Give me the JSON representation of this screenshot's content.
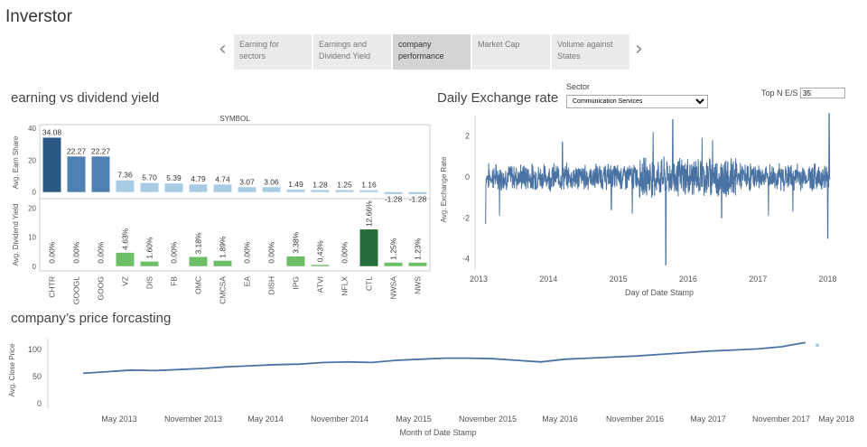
{
  "app": {
    "title": "Inverstor"
  },
  "tabs": [
    {
      "label_line1": "Earning for",
      "label_line2": "sectors",
      "active": false
    },
    {
      "label_line1": "Earnings and",
      "label_line2": "Dividend Yield",
      "active": false
    },
    {
      "label_line1": "company",
      "label_line2": "performance",
      "active": true
    },
    {
      "label_line1": "Market Cap",
      "label_line2": "",
      "active": false
    },
    {
      "label_line1": "Volume against",
      "label_line2": "States",
      "active": false
    }
  ],
  "nav": {
    "prev": "‹",
    "next": "›"
  },
  "earning_section": {
    "title": "earning vs dividend yield",
    "header": "SYMBOL",
    "eps_axis_label": "Avg. Earn Share",
    "div_axis_label": "Avg. Dividend Yield"
  },
  "exchange_section": {
    "title": "Daily Exchange rate",
    "sector_label": "Sector",
    "sector_value": "Communication Services",
    "topn_label": "Top N E/S",
    "topn_value": "35",
    "y_label": "Avg. Exchange Rate",
    "x_label": "Day of Date Stamp"
  },
  "forecast_section": {
    "title": "company’s price forcasting",
    "y_label": "Avg. Close Price",
    "x_label": "Month of Date Stamp"
  },
  "colors": {
    "eps_dark": "#2a5783",
    "eps_mid": "#4f80b4",
    "eps_light": "#a8cce6",
    "div_dark": "#266d3a",
    "div_mid": "#6cbf66",
    "line": "#4a73a3"
  },
  "chart_data": [
    {
      "type": "bar",
      "title": "",
      "ylabel": "Avg. Earn Share",
      "categories": [
        "CHTR",
        "GOOGL",
        "GOOG",
        "VZ",
        "DIS",
        "FB",
        "OMC",
        "CMCSA",
        "EA",
        "DISH",
        "IPG",
        "ATVI",
        "NFLX",
        "CTL",
        "NWSA",
        "NWS"
      ],
      "values": [
        34.08,
        22.27,
        22.27,
        7.36,
        5.7,
        5.39,
        4.79,
        4.74,
        3.07,
        3.06,
        1.49,
        1.28,
        1.25,
        1.16,
        -1.28,
        -1.28
      ],
      "labels": [
        "34.08",
        "22.27",
        "22.27",
        "7.36",
        "5.70",
        "5.39",
        "4.79",
        "4.74",
        "3.07",
        "3.06",
        "1.49",
        "1.28",
        "1.25",
        "1.16",
        "-1.28",
        "-1.28"
      ],
      "ylim": [
        -3,
        40
      ],
      "yticks": [
        "0",
        "20",
        "40"
      ]
    },
    {
      "type": "bar",
      "title": "",
      "ylabel": "Avg. Dividend Yield",
      "categories": [
        "CHTR",
        "GOOGL",
        "GOOG",
        "VZ",
        "DIS",
        "FB",
        "OMC",
        "CMCSA",
        "EA",
        "DISH",
        "IPG",
        "ATVI",
        "NFLX",
        "CTL",
        "NWSA",
        "NWS"
      ],
      "values": [
        0,
        0,
        0,
        4.63,
        1.6,
        0,
        3.18,
        1.89,
        0,
        0,
        3.38,
        0.43,
        0,
        12.66,
        1.25,
        1.23
      ],
      "labels": [
        "0.00%",
        "0.00%",
        "0.00%",
        "4.63%",
        "1.60%",
        "0.00%",
        "3.18%",
        "1.89%",
        "0.00%",
        "0.00%",
        "3.38%",
        "0.43%",
        "0.00%",
        "12.66%",
        "1.25%",
        "1.23%"
      ],
      "ylim": [
        -1,
        22
      ],
      "yticks": [
        "0",
        "10",
        "20"
      ]
    },
    {
      "type": "line",
      "title": "",
      "xlabel": "Day of Date Stamp",
      "ylabel": "Avg. Exchange Rate",
      "x_ticks": [
        "2013",
        "2014",
        "2015",
        "2016",
        "2017",
        "2018"
      ],
      "y_ticks": [
        "-4",
        "-2",
        "0",
        "2"
      ],
      "xlim": [
        2013,
        2018.2
      ],
      "ylim": [
        -4.5,
        3
      ],
      "series": [
        {
          "generated": "noisy daily series around 0",
          "spikes": [
            [
              2013.1,
              -2.3
            ],
            [
              2013.3,
              -1.9
            ],
            [
              2014.2,
              1.7
            ],
            [
              2014.9,
              -1.6
            ],
            [
              2015.2,
              -1.8
            ],
            [
              2015.5,
              2.2
            ],
            [
              2015.68,
              -4.3
            ],
            [
              2015.78,
              2.8
            ],
            [
              2016.2,
              1.9
            ],
            [
              2016.35,
              1.8
            ],
            [
              2016.48,
              -2.0
            ],
            [
              2017.15,
              -1.9
            ],
            [
              2017.5,
              -1.7
            ],
            [
              2018.0,
              -3.0
            ],
            [
              2018.02,
              3.1
            ]
          ]
        }
      ]
    },
    {
      "type": "line",
      "title": "",
      "xlabel": "Month of Date Stamp",
      "ylabel": "Avg. Close Price",
      "x_ticks": [
        "May 2013",
        "November 2013",
        "May 2014",
        "November 2014",
        "May 2015",
        "November 2015",
        "May 2016",
        "November 2016",
        "May 2017",
        "November 2017",
        "May 2018"
      ],
      "y_ticks": [
        "0",
        "50",
        "100"
      ],
      "ylim": [
        0,
        120
      ],
      "x": [
        "Feb 2013",
        "Apr 2013",
        "Jun 2013",
        "Aug 2013",
        "Oct 2013",
        "Dec 2013",
        "Feb 2014",
        "Apr 2014",
        "Jun 2014",
        "Aug 2014",
        "Oct 2014",
        "Dec 2014",
        "Feb 2015",
        "Apr 2015",
        "Jun 2015",
        "Aug 2015",
        "Oct 2015",
        "Dec 2015",
        "Feb 2016",
        "Apr 2016",
        "Jun 2016",
        "Aug 2016",
        "Oct 2016",
        "Dec 2016",
        "Feb 2017",
        "Apr 2017",
        "Jun 2017",
        "Aug 2017",
        "Oct 2017",
        "Dec 2017",
        "Feb 2018"
      ],
      "values": [
        56,
        59,
        62,
        61,
        63,
        65,
        68,
        70,
        72,
        73,
        76,
        77,
        76,
        80,
        82,
        84,
        84,
        83,
        80,
        77,
        82,
        84,
        86,
        88,
        91,
        94,
        97,
        99,
        101,
        105,
        113
      ]
    }
  ]
}
